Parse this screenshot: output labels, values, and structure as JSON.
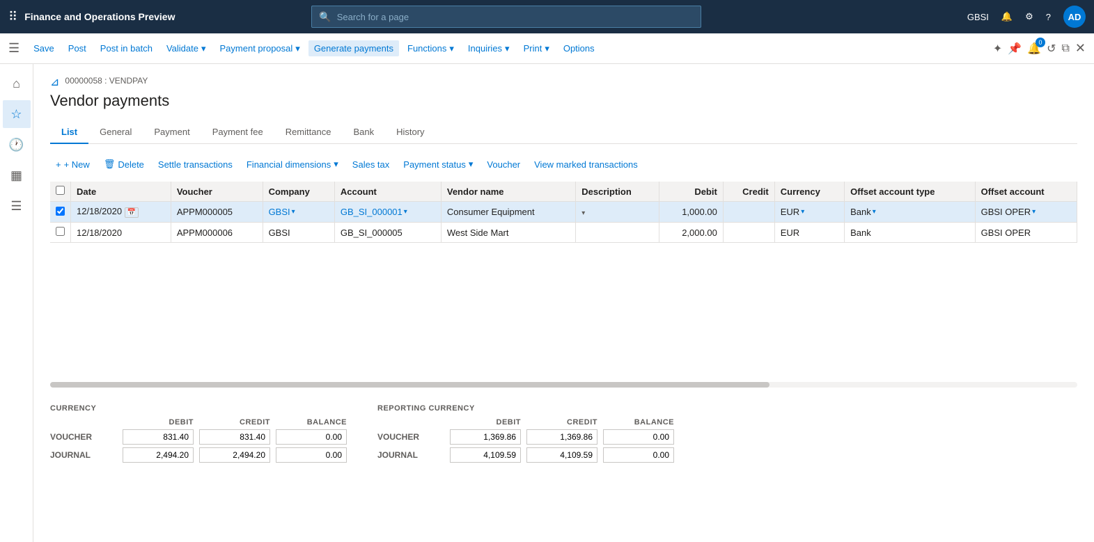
{
  "app": {
    "title": "Finance and Operations Preview"
  },
  "search": {
    "placeholder": "Search for a page"
  },
  "topnav": {
    "user": "GBSI",
    "avatar": "AD"
  },
  "toolbar": {
    "save_label": "Save",
    "post_label": "Post",
    "post_in_batch_label": "Post in batch",
    "validate_label": "Validate",
    "payment_proposal_label": "Payment proposal",
    "generate_payments_label": "Generate payments",
    "functions_label": "Functions",
    "inquiries_label": "Inquiries",
    "print_label": "Print",
    "options_label": "Options"
  },
  "breadcrumb": "00000058 : VENDPAY",
  "page_title": "Vendor payments",
  "tabs": [
    {
      "id": "list",
      "label": "List",
      "active": true
    },
    {
      "id": "general",
      "label": "General"
    },
    {
      "id": "payment",
      "label": "Payment"
    },
    {
      "id": "payment-fee",
      "label": "Payment fee"
    },
    {
      "id": "remittance",
      "label": "Remittance"
    },
    {
      "id": "bank",
      "label": "Bank"
    },
    {
      "id": "history",
      "label": "History"
    }
  ],
  "actions": {
    "new_label": "+ New",
    "delete_label": "Delete",
    "settle_label": "Settle transactions",
    "financial_dimensions_label": "Financial dimensions",
    "sales_tax_label": "Sales tax",
    "payment_status_label": "Payment status",
    "voucher_label": "Voucher",
    "view_marked_label": "View marked transactions"
  },
  "table": {
    "columns": [
      {
        "id": "date",
        "label": "Date"
      },
      {
        "id": "voucher",
        "label": "Voucher"
      },
      {
        "id": "company",
        "label": "Company"
      },
      {
        "id": "account",
        "label": "Account"
      },
      {
        "id": "vendor_name",
        "label": "Vendor name"
      },
      {
        "id": "description",
        "label": "Description"
      },
      {
        "id": "debit",
        "label": "Debit",
        "align": "right"
      },
      {
        "id": "credit",
        "label": "Credit",
        "align": "right"
      },
      {
        "id": "currency",
        "label": "Currency"
      },
      {
        "id": "offset_account_type",
        "label": "Offset account type"
      },
      {
        "id": "offset_account",
        "label": "Offset account"
      }
    ],
    "rows": [
      {
        "selected": true,
        "date": "12/18/2020",
        "voucher": "APPM000005",
        "company": "GBSI",
        "account": "GB_SI_000001",
        "vendor_name": "Consumer Equipment",
        "description": "",
        "debit": "1,000.00",
        "credit": "",
        "currency": "EUR",
        "offset_account_type": "Bank",
        "offset_account": "GBSI OPER"
      },
      {
        "selected": false,
        "date": "12/18/2020",
        "voucher": "APPM000006",
        "company": "GBSI",
        "account": "GB_SI_000005",
        "vendor_name": "West Side Mart",
        "description": "",
        "debit": "2,000.00",
        "credit": "",
        "currency": "EUR",
        "offset_account_type": "Bank",
        "offset_account": "GBSI OPER"
      }
    ]
  },
  "footer": {
    "currency_title": "CURRENCY",
    "reporting_currency_title": "REPORTING CURRENCY",
    "col_debit": "DEBIT",
    "col_credit": "CREDIT",
    "col_balance": "BALANCE",
    "rows": [
      {
        "label": "VOUCHER",
        "debit": "831.40",
        "credit": "831.40",
        "balance": "0.00",
        "rep_debit": "1,369.86",
        "rep_credit": "1,369.86",
        "rep_balance": "0.00"
      },
      {
        "label": "JOURNAL",
        "debit": "2,494.20",
        "credit": "2,494.20",
        "balance": "0.00",
        "rep_debit": "4,109.59",
        "rep_credit": "4,109.59",
        "rep_balance": "0.00"
      }
    ]
  },
  "sidebar": {
    "items": [
      {
        "id": "home",
        "icon": "⌂",
        "label": "Home"
      },
      {
        "id": "favorites",
        "icon": "☆",
        "label": "Favorites"
      },
      {
        "id": "recent",
        "icon": "🕐",
        "label": "Recent"
      },
      {
        "id": "workspaces",
        "icon": "▦",
        "label": "Workspaces"
      },
      {
        "id": "modules",
        "icon": "☰",
        "label": "Modules"
      }
    ]
  }
}
